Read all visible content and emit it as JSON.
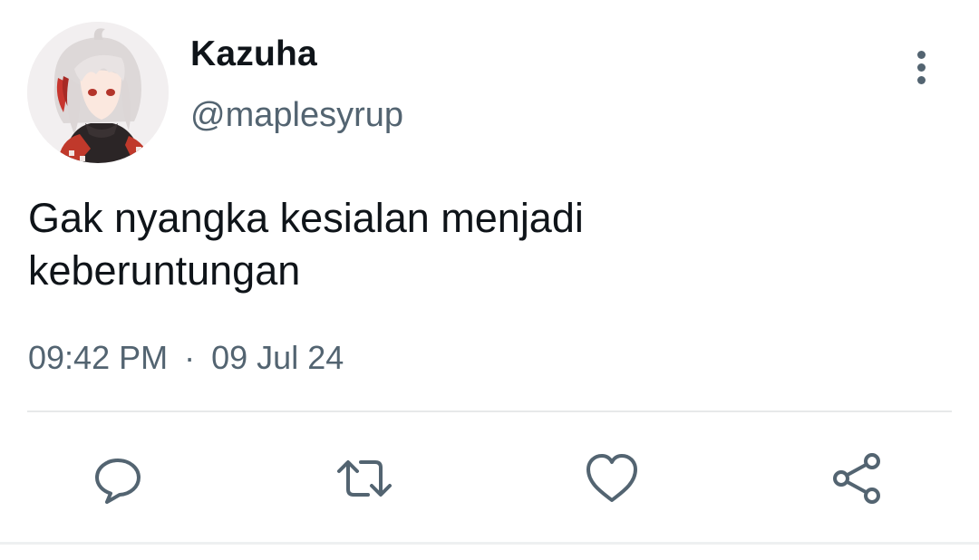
{
  "tweet": {
    "display_name": "Kazuha",
    "handle": "@maplesyrup",
    "text": "Gak nyangka kesialan menjadi\nkeberuntungan",
    "time": "09:42 PM",
    "separator": "·",
    "date": "09 Jul 24"
  },
  "actions": {
    "reply_icon": "reply-icon",
    "retweet_icon": "retweet-icon",
    "like_icon": "heart-icon",
    "share_icon": "share-icon"
  },
  "icons": {
    "more": "more-vertical-icon"
  },
  "colors": {
    "primary_text": "#0f1419",
    "secondary_text": "#536471",
    "icon_gray": "#536471",
    "divider": "#e7e9ea"
  }
}
